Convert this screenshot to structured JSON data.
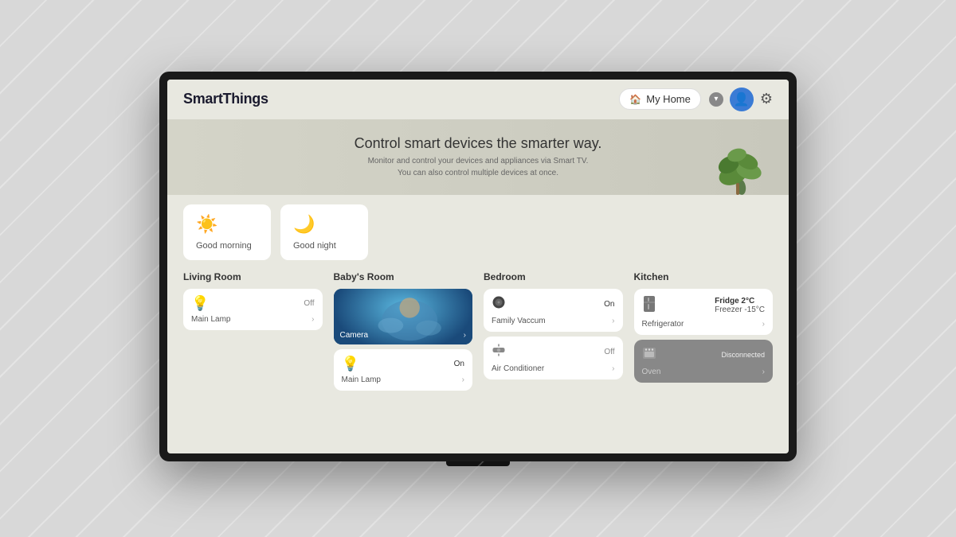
{
  "app": {
    "logo": "SmartThings"
  },
  "header": {
    "home_selector": {
      "label": "My Home",
      "icon": "🏠"
    },
    "avatar_icon": "👤",
    "settings_icon": "⚙"
  },
  "banner": {
    "title": "Control smart devices the smarter way.",
    "subtitle_line1": "Monitor and control your devices and appliances via Smart TV.",
    "subtitle_line2": "You can also control multiple devices at once."
  },
  "time_cards": [
    {
      "icon": "☀️",
      "label": "Good morning"
    },
    {
      "icon": "🌙",
      "label": "Good night"
    }
  ],
  "rooms": [
    {
      "name": "Living Room",
      "devices": [
        {
          "icon": "💡",
          "status": "Off",
          "status_on": false,
          "name": "Main Lamp",
          "type": "lamp"
        }
      ]
    },
    {
      "name": "Baby's Room",
      "devices": [
        {
          "type": "camera",
          "name": "Camera"
        },
        {
          "icon": "💡",
          "status": "On",
          "status_on": true,
          "name": "Main Lamp",
          "type": "lamp-on"
        }
      ]
    },
    {
      "name": "Bedroom",
      "devices": [
        {
          "icon": "🤖",
          "status": "On",
          "status_on": true,
          "name": "Family Vaccum",
          "type": "vacuum"
        },
        {
          "icon": "❄️",
          "status": "Off",
          "status_on": false,
          "name": "Air Conditioner",
          "type": "ac"
        }
      ]
    },
    {
      "name": "Kitchen",
      "devices": [
        {
          "icon": "🧊",
          "status_line1": "Fridge 2°C",
          "status_line2": "Freezer -15°C",
          "name": "Refrigerator",
          "type": "fridge"
        },
        {
          "icon": "🍳",
          "status": "Disconnected",
          "name": "Oven",
          "type": "oven",
          "disconnected": true
        }
      ]
    }
  ]
}
